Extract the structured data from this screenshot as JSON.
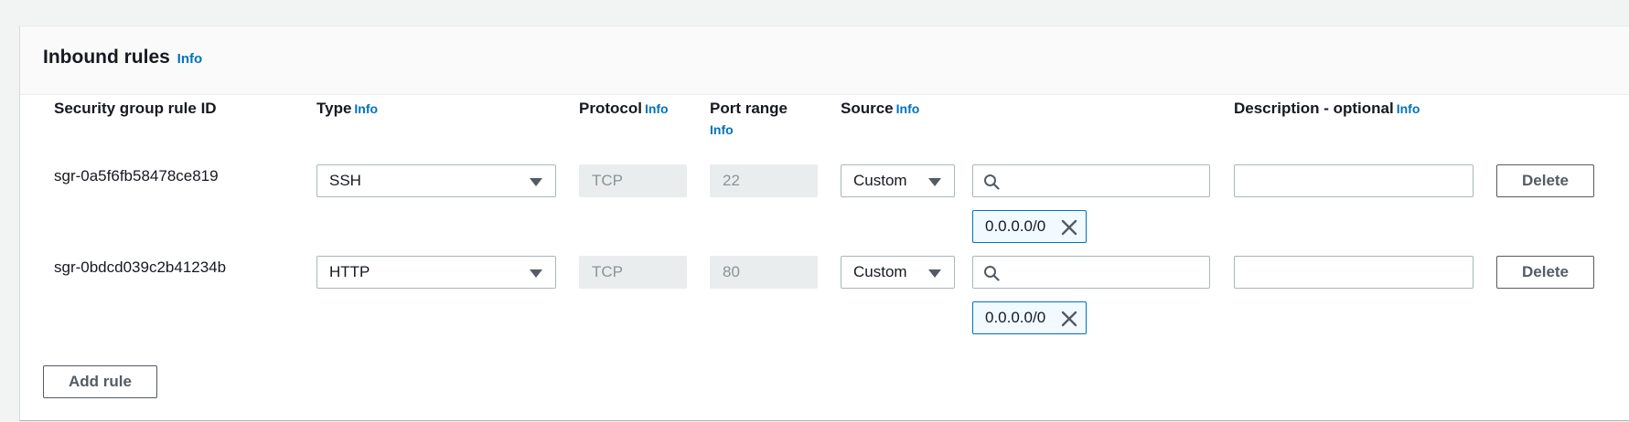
{
  "section": {
    "title": "Inbound rules",
    "title_info": "Info"
  },
  "columns": {
    "rule_id": "Security group rule ID",
    "type": "Type",
    "type_info": "Info",
    "protocol": "Protocol",
    "protocol_info": "Info",
    "port_range": "Port range",
    "port_range_info": "Info",
    "source": "Source",
    "source_info": "Info",
    "description": "Description - optional",
    "description_info": "Info"
  },
  "rules": [
    {
      "rule_id": "sgr-0a5f6fb58478ce819",
      "type": "SSH",
      "protocol": "TCP",
      "port_range": "22",
      "source_mode": "Custom",
      "source_token": "0.0.0.0/0",
      "description": "",
      "delete_label": "Delete"
    },
    {
      "rule_id": "sgr-0bdcd039c2b41234b",
      "type": "HTTP",
      "protocol": "TCP",
      "port_range": "80",
      "source_mode": "Custom",
      "source_token": "0.0.0.0/0",
      "description": "",
      "delete_label": "Delete"
    }
  ],
  "add_rule_label": "Add rule",
  "icons": {
    "search": "search-icon",
    "caret": "caret-down-icon",
    "remove": "close-icon"
  },
  "colors": {
    "link": "#0073bb",
    "token_border": "#0073bb",
    "token_bg": "#f1faff",
    "button_text": "#545b64"
  }
}
